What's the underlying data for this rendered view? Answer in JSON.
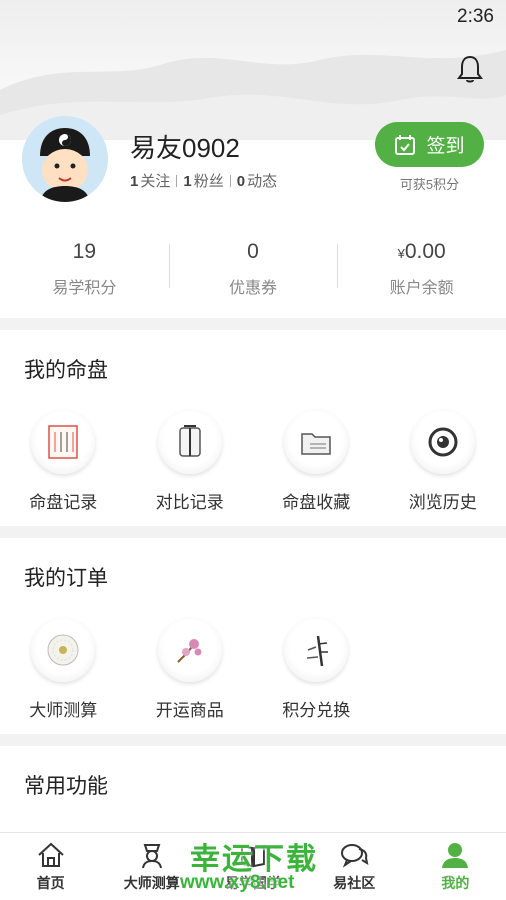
{
  "status_bar": {
    "time": "2:36"
  },
  "profile": {
    "username": "易友0902",
    "following_count": "1",
    "following_label": "关注",
    "fans_count": "1",
    "fans_label": "粉丝",
    "posts_count": "0",
    "posts_label": "动态",
    "signin_label": "签到",
    "signin_hint": "可获5积分"
  },
  "stats": [
    {
      "value": "19",
      "label": "易学积分"
    },
    {
      "value": "0",
      "label": "优惠券"
    },
    {
      "currency": "¥",
      "value": "0.00",
      "label": "账户余额"
    }
  ],
  "my_charts": {
    "title": "我的命盘",
    "items": [
      {
        "label": "命盘记录",
        "icon": "scroll-record-icon"
      },
      {
        "label": "对比记录",
        "icon": "compare-scroll-icon"
      },
      {
        "label": "命盘收藏",
        "icon": "folder-collection-icon"
      },
      {
        "label": "浏览历史",
        "icon": "eye-history-icon"
      }
    ]
  },
  "my_orders": {
    "title": "我的订单",
    "items": [
      {
        "label": "大师测算",
        "icon": "jade-disc-icon"
      },
      {
        "label": "开运商品",
        "icon": "plum-blossom-icon"
      },
      {
        "label": "积分兑换",
        "icon": "bamboo-icon"
      }
    ]
  },
  "common_functions": {
    "title": "常用功能"
  },
  "tabbar": [
    {
      "label": "首页",
      "icon": "home-icon",
      "active": false
    },
    {
      "label": "大师测算",
      "icon": "master-icon",
      "active": false
    },
    {
      "label": "易学国学",
      "icon": "book-icon",
      "active": false
    },
    {
      "label": "易社区",
      "icon": "chat-icon",
      "active": false
    },
    {
      "label": "我的",
      "icon": "user-icon",
      "active": true
    }
  ],
  "watermark": {
    "title": "幸运下载",
    "url": "www.xy8.net"
  },
  "colors": {
    "accent": "#52b044",
    "text": "#333333",
    "divider": "#f2f2f2"
  }
}
